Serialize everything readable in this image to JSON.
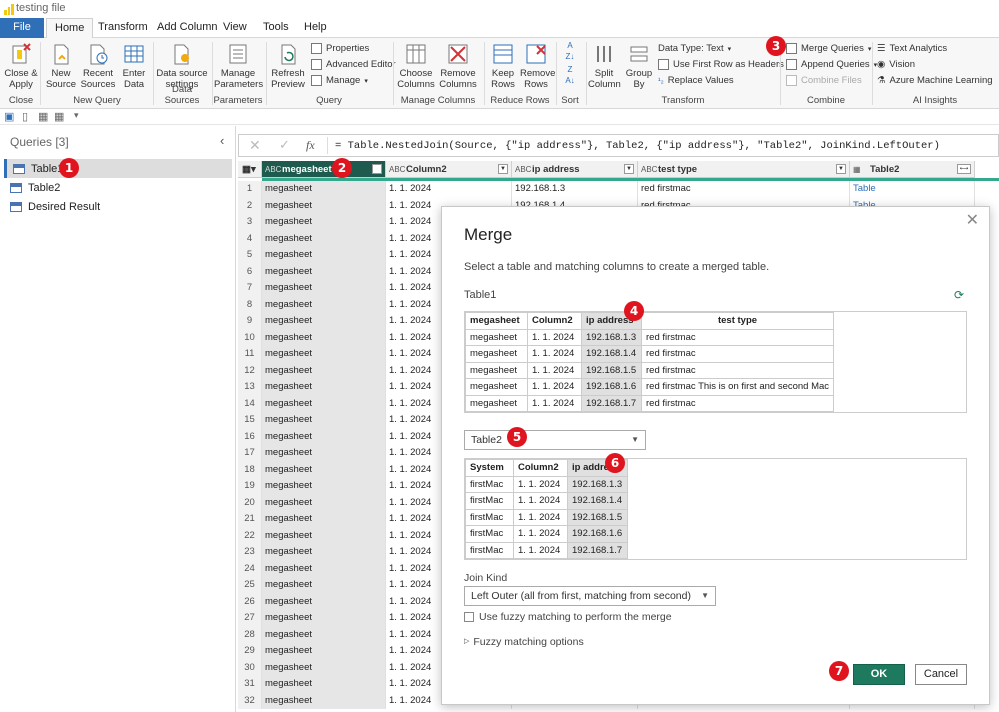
{
  "app": {
    "title": "testing file"
  },
  "tabs": [
    {
      "label": "File"
    },
    {
      "label": "Home"
    },
    {
      "label": "Transform"
    },
    {
      "label": "Add Column"
    },
    {
      "label": "View"
    },
    {
      "label": "Tools"
    },
    {
      "label": "Help"
    }
  ],
  "ribbon": {
    "close_apply": "Close &",
    "close_apply2": "Apply",
    "close_group": "Close",
    "new_source": "New",
    "new_source2": "Source",
    "recent_sources": "Recent",
    "recent_sources2": "Sources",
    "enter_data": "Enter",
    "enter_data2": "Data",
    "new_query_group": "New Query",
    "ds_settings": "Data source",
    "ds_settings2": "settings",
    "data_sources_group": "Data Sources",
    "manage_params": "Manage",
    "manage_params2": "Parameters",
    "parameters_group": "Parameters",
    "refresh": "Refresh",
    "refresh2": "Preview",
    "properties": "Properties",
    "advanced_editor": "Advanced Editor",
    "manage": "Manage",
    "query_group": "Query",
    "choose_cols": "Choose",
    "choose_cols2": "Columns",
    "remove_cols": "Remove",
    "remove_cols2": "Columns",
    "manage_columns_group": "Manage Columns",
    "keep_rows": "Keep",
    "keep_rows2": "Rows",
    "remove_rows": "Remove",
    "remove_rows2": "Rows",
    "reduce_rows_group": "Reduce Rows",
    "sort_group": "Sort",
    "split_col": "Split",
    "split_col2": "Column",
    "group_by": "Group",
    "group_by2": "By",
    "data_type": "Data Type: Text",
    "first_row_headers": "Use First Row as Headers",
    "replace_values": "Replace Values",
    "transform_group": "Transform",
    "merge_queries": "Merge Queries",
    "append_queries": "Append Queries",
    "combine_files": "Combine Files",
    "combine_group": "Combine",
    "text_analytics": "Text Analytics",
    "vision": "Vision",
    "azure_ml": "Azure Machine Learning",
    "ai_group": "AI Insights"
  },
  "queries": {
    "header": "Queries [3]",
    "items": [
      {
        "label": "Table1"
      },
      {
        "label": "Table2"
      },
      {
        "label": "Desired Result"
      }
    ]
  },
  "formula": "= Table.NestedJoin(Source, {\"ip address\"}, Table2, {\"ip address\"}, \"Table2\", JoinKind.LeftOuter)",
  "grid": {
    "columns": [
      {
        "type": "ABC",
        "name": "megasheet"
      },
      {
        "type": "ABC",
        "name": "Column2"
      },
      {
        "type": "ABC",
        "name": "ip address"
      },
      {
        "type": "ABC",
        "name": "test type"
      },
      {
        "type": "",
        "name": "Table2"
      }
    ],
    "visible_top": {
      "row1": [
        "megasheet",
        "1. 1. 2024",
        "192.168.1.3",
        "red firstmac",
        "Table"
      ],
      "row2": [
        "megasheet",
        "1. 1. 2024",
        "192.168.1.4",
        "red firstmac",
        "Table"
      ]
    },
    "row_value_col1": "megasheet",
    "row_value_col2": "1. 1. 2024",
    "row_count": 32
  },
  "merge": {
    "title": "Merge",
    "description": "Select a table and matching columns to create a merged table.",
    "table1_label": "Table1",
    "table1_headers": [
      "megasheet",
      "Column2",
      "ip address",
      "test type"
    ],
    "table1_rows": [
      [
        "megasheet",
        "1. 1. 2024",
        "192.168.1.3",
        "red firstmac"
      ],
      [
        "megasheet",
        "1. 1. 2024",
        "192.168.1.4",
        "red firstmac"
      ],
      [
        "megasheet",
        "1. 1. 2024",
        "192.168.1.5",
        "red firstmac"
      ],
      [
        "megasheet",
        "1. 1. 2024",
        "192.168.1.6",
        "red firstmac This is on first and second Mac"
      ],
      [
        "megasheet",
        "1. 1. 2024",
        "192.168.1.7",
        "red firstmac"
      ]
    ],
    "table2_select": "Table2",
    "table2_headers": [
      "System",
      "Column2",
      "ip address"
    ],
    "table2_rows": [
      [
        "firstMac",
        "1. 1. 2024",
        "192.168.1.3"
      ],
      [
        "firstMac",
        "1. 1. 2024",
        "192.168.1.4"
      ],
      [
        "firstMac",
        "1. 1. 2024",
        "192.168.1.5"
      ],
      [
        "firstMac",
        "1. 1. 2024",
        "192.168.1.6"
      ],
      [
        "firstMac",
        "1. 1. 2024",
        "192.168.1.7"
      ]
    ],
    "join_kind_label": "Join Kind",
    "join_kind_value": "Left Outer (all from first, matching from second)",
    "fuzzy_checkbox": "Use fuzzy matching to perform the merge",
    "fuzzy_options": "Fuzzy matching options",
    "ok": "OK",
    "cancel": "Cancel"
  },
  "badges": [
    "1",
    "2",
    "3",
    "4",
    "5",
    "6",
    "7"
  ],
  "colors": {
    "accent": "#2e6fb8",
    "ok_button": "#1e7a5e",
    "badge": "#e0141e",
    "selected_header": "#1e5a4d"
  }
}
